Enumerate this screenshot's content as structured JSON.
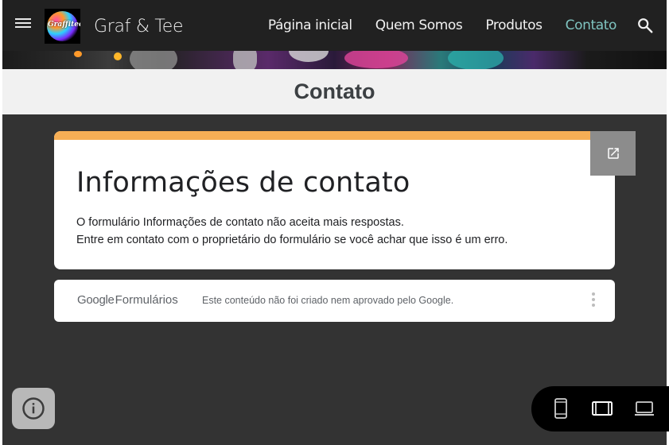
{
  "header": {
    "site_title": "Graf & Tee",
    "logo_text": "Graffitee",
    "nav": [
      {
        "label": "Página inicial",
        "active": false
      },
      {
        "label": "Quem Somos",
        "active": false
      },
      {
        "label": "Produtos",
        "active": false
      },
      {
        "label": "Contato",
        "active": true
      }
    ],
    "menu_icon": "hamburger-menu-icon",
    "search_icon": "search-icon",
    "active_color": "#7fc4c0"
  },
  "section": {
    "title": "Contato"
  },
  "form": {
    "title": "Informações de contato",
    "message_line1": "O formulário Informações de contato não aceita mais respostas.",
    "message_line2": "Entre em contato com o proprietário do formulário se você achar que isso é um erro.",
    "accent_color": "#f6ae55",
    "open_icon": "open-in-new-icon"
  },
  "footer": {
    "brand_google": "Google",
    "brand_forms": "Formulários",
    "disclaimer": "Este conteúdo não foi criado nem aprovado pelo Google.",
    "more_icon": "more-vertical-icon"
  },
  "controls": {
    "info_icon": "info-icon",
    "preview_modes": [
      "phone-icon",
      "tablet-icon",
      "laptop-icon"
    ]
  }
}
